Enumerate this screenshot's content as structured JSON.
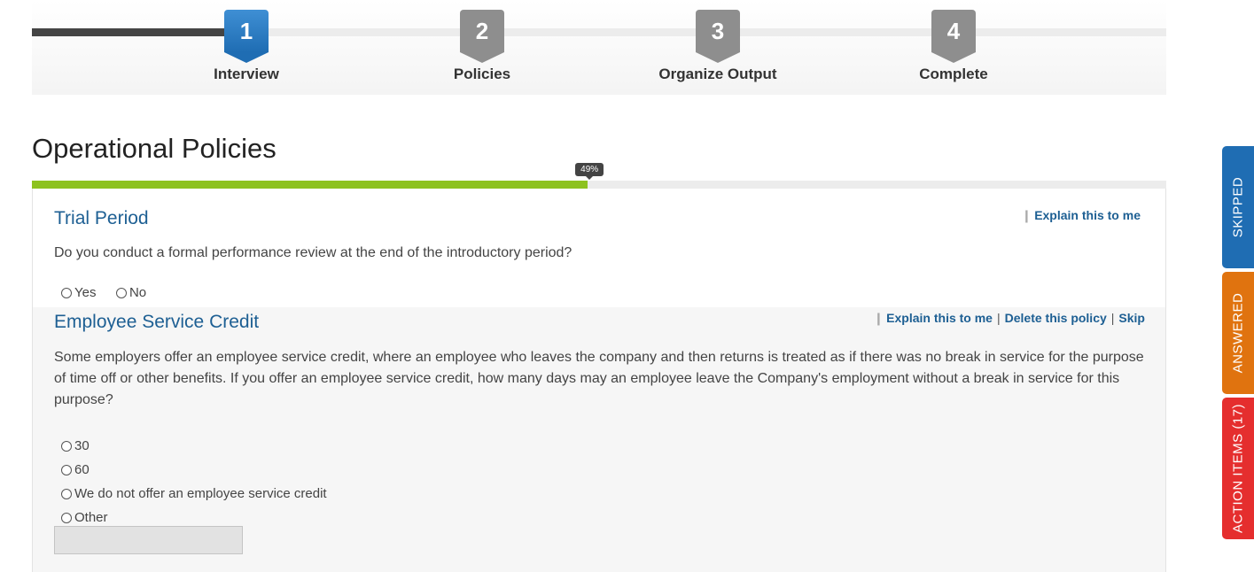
{
  "wizard": {
    "steps": [
      {
        "number": "1",
        "label": "Interview"
      },
      {
        "number": "2",
        "label": "Policies"
      },
      {
        "number": "3",
        "label": "Organize Output"
      },
      {
        "number": "4",
        "label": "Complete"
      }
    ],
    "active_step": 1
  },
  "page": {
    "title": "Operational Policies"
  },
  "progress": {
    "label": "49%",
    "value": 0.49,
    "color": "#8dc21f"
  },
  "questions": [
    {
      "title": "Trial Period",
      "text": "Do you conduct a formal performance review at the end of the introductory period?",
      "links": {
        "explain": "Explain this to me"
      },
      "options": [
        "Yes",
        "No"
      ]
    },
    {
      "title": "Employee Service Credit",
      "text": "Some employers offer an employee service credit, where an employee who leaves the company and then returns is treated as if there was no break in service for the purpose of time off or other benefits. If you offer an employee service credit, how many days may an employee leave the Company's employment without a break in service for this purpose?",
      "links": {
        "explain": "Explain this to me",
        "delete": "Delete this policy",
        "skip": "Skip"
      },
      "options": [
        "30",
        "60",
        "We do not offer an employee service credit",
        "Other"
      ],
      "other_value": ""
    }
  ],
  "side_tabs": {
    "skipped": "SKIPPED",
    "answered": "ANSWERED",
    "action_items": "ACTION ITEMS (17)"
  },
  "colors": {
    "active_step": "#1f6db3",
    "inactive_step": "#8e8e8e",
    "skipped_tab": "#1f6db3",
    "answered_tab": "#e0730f",
    "action_tab": "#e52e2e",
    "question_title": "#1d5f93"
  }
}
